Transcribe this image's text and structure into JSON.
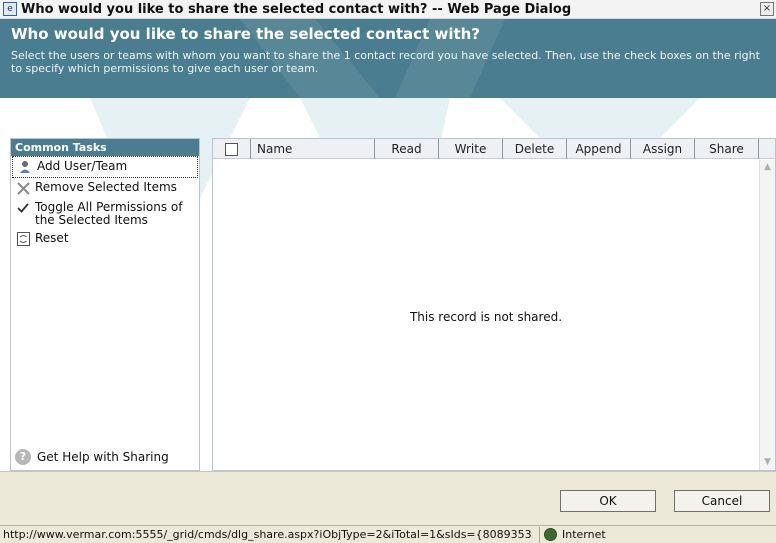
{
  "window": {
    "title": "Who would you like to share the selected contact with? -- Web Page Dialog",
    "close_glyph": "×"
  },
  "header": {
    "heading": "Who would you like to share the selected contact with?",
    "description": "Select the users or teams with whom you want to share the 1 contact record you have selected. Then, use the check boxes on the right to specify which permissions to give each user or team.",
    "band_color": "#4a7d8f"
  },
  "sidebar": {
    "title": "Common Tasks",
    "items": [
      {
        "label": "Add User/Team",
        "icon": "user-icon"
      },
      {
        "label": "Remove Selected Items",
        "icon": "remove-x-icon"
      },
      {
        "label": "Toggle All Permissions of the Selected Items",
        "icon": "checkmark-icon"
      },
      {
        "label": "Reset",
        "icon": "reset-icon"
      }
    ],
    "help_label": "Get Help with Sharing"
  },
  "grid": {
    "columns": [
      "Name",
      "Read",
      "Write",
      "Delete",
      "Append",
      "Assign",
      "Share"
    ],
    "empty_message": "This record is not shared."
  },
  "footer": {
    "ok_label": "OK",
    "cancel_label": "Cancel"
  },
  "statusbar": {
    "url": "http://www.vermar.com:5555/_grid/cmds/dlg_share.aspx?iObjType=2&iTotal=1&sIds={8089353",
    "zone": "Internet"
  }
}
